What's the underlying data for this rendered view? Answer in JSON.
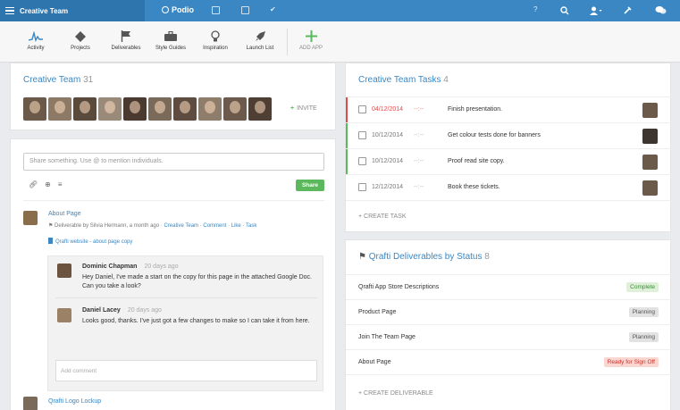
{
  "topbar": {
    "team_name": "Creative Team",
    "logo_text": "Podio",
    "help": "?"
  },
  "apps": [
    {
      "label": "Activity",
      "icon": "activity-icon"
    },
    {
      "label": "Projects",
      "icon": "diamond-icon"
    },
    {
      "label": "Deliverables",
      "icon": "flag-icon"
    },
    {
      "label": "Style Guides",
      "icon": "briefcase-icon"
    },
    {
      "label": "Inspiration",
      "icon": "lightbulb-icon"
    },
    {
      "label": "Launch List",
      "icon": "rocket-icon"
    },
    {
      "label": "ADD APP",
      "icon": "plus-icon"
    }
  ],
  "team": {
    "title": "Creative Team",
    "count": "31",
    "invite": "INVITE",
    "avatar_colors": [
      "#6b5a4a",
      "#8c7a66",
      "#5a4a3c",
      "#9a8a7a",
      "#4a3a30",
      "#7a6a5a",
      "#5d4c3f",
      "#8f7d6c",
      "#6c5b4c",
      "#4e3e33",
      "#a08f7e"
    ]
  },
  "feed": {
    "share_placeholder": "Share something. Use @ to mention individuals.",
    "share_button": "Share",
    "post": {
      "title": "About Page",
      "meta_prefix": "Deliverable by Silvia Hermann, a month ago",
      "sep": "·",
      "workspace": "Creative Team",
      "actions": [
        "Comment",
        "Like",
        "Task"
      ],
      "doc_link": "Qrafti website - about page copy"
    },
    "comments": [
      {
        "name": "Dominic Chapman",
        "time": "20 days ago",
        "text": "Hey Daniel, I've made a start on the copy for this page in the attached Google Doc. Can you take a look?"
      },
      {
        "name": "Daniel Lacey",
        "time": "20 days ago",
        "text": "Looks good, thanks. I've just got a few changes to make so I can take it from here."
      }
    ],
    "comment_placeholder": "Add comment",
    "next_post_title": "Qrafti Logo Lockup"
  },
  "tasks": {
    "title": "Creative Team Tasks",
    "count": "4",
    "items": [
      {
        "date": "04/12/2014",
        "dash": "--:--",
        "text": "Finish presentation.",
        "status_color": "#e04b4b"
      },
      {
        "date": "10/12/2014",
        "dash": "--:--",
        "text": "Get colour tests done for banners",
        "status_color": "#5cb85c"
      },
      {
        "date": "10/12/2014",
        "dash": "--:--",
        "text": "Proof read site copy.",
        "status_color": "#5cb85c"
      },
      {
        "date": "12/12/2014",
        "dash": "--:--",
        "text": "Book these tickets.",
        "status_color": ""
      }
    ],
    "create_label": "+ CREATE TASK"
  },
  "deliverables": {
    "title": "Qrafti Deliverables by Status",
    "count": "8",
    "items": [
      {
        "name": "Qrafti App Store Descriptions",
        "status": "Complete"
      },
      {
        "name": "Product Page",
        "status": "Planning"
      },
      {
        "name": "Join The Team Page",
        "status": "Planning"
      },
      {
        "name": "About Page",
        "status": "Ready for Sign Off"
      }
    ],
    "create_label": "+ CREATE DELIVERABLE"
  },
  "colors": {
    "accent": "#3a87c3",
    "green": "#5cb85c",
    "red": "#e04b4b"
  }
}
